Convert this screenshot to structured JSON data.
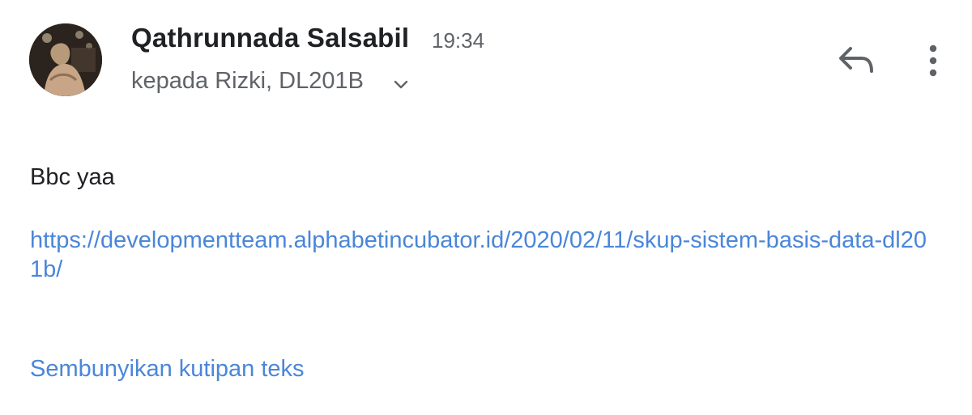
{
  "header": {
    "sender_name": "Qathrunnada Salsabil",
    "time": "19:34",
    "recipients": "kepada Rizki, DL201B",
    "avatar_icon": "profile-photo",
    "expand_icon": "chevron-down-icon",
    "reply_icon": "reply-icon",
    "more_icon": "more-vert-icon"
  },
  "message": {
    "body": "Bbc yaa",
    "link": "https://developmentteam.alphabetincubator.id/2020/02/11/skup-sistem-basis-data-dl201b/"
  },
  "actions": {
    "hide_quoted": "Sembunyikan kutipan teks"
  },
  "colors": {
    "text_primary": "#202124",
    "text_secondary": "#5f6368",
    "link": "#4a86d9"
  }
}
